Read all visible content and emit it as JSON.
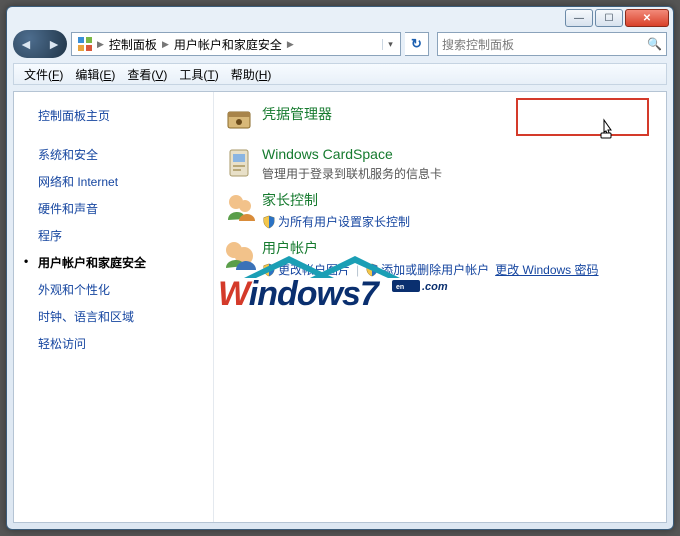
{
  "titlebar": {
    "min": "—",
    "max": "☐",
    "close": "✕"
  },
  "breadcrumb": {
    "items": [
      "控制面板",
      "用户帐户和家庭安全",
      ""
    ]
  },
  "refresh_icon": "↻",
  "search": {
    "placeholder": "搜索控制面板"
  },
  "menus": [
    {
      "pre": "文件(",
      "u": "F",
      "post": ")"
    },
    {
      "pre": "编辑(",
      "u": "E",
      "post": ")"
    },
    {
      "pre": "查看(",
      "u": "V",
      "post": ")"
    },
    {
      "pre": "工具(",
      "u": "T",
      "post": ")"
    },
    {
      "pre": "帮助(",
      "u": "H",
      "post": ")"
    }
  ],
  "sidebar": {
    "items": [
      {
        "label": "控制面板主页"
      },
      {
        "label": "系统和安全"
      },
      {
        "label": "网络和 Internet"
      },
      {
        "label": "硬件和声音"
      },
      {
        "label": "程序"
      },
      {
        "label": "用户帐户和家庭安全",
        "active": true
      },
      {
        "label": "外观和个性化"
      },
      {
        "label": "时钟、语言和区域"
      },
      {
        "label": "轻松访问"
      }
    ]
  },
  "main": {
    "sections": [
      {
        "title": "用户帐户",
        "tasks": [
          {
            "shield": true,
            "label": "更改帐户图片"
          },
          {
            "sep": "|"
          },
          {
            "shield": true,
            "label": "添加或删除用户帐户"
          },
          {
            "label": "更改 Windows 密码",
            "underline": true
          }
        ]
      },
      {
        "title": "家长控制",
        "tasks": [
          {
            "shield": true,
            "label": "为所有用户设置家长控制"
          }
        ]
      },
      {
        "title": "Windows CardSpace",
        "desc": "管理用于登录到联机服务的信息卡"
      },
      {
        "title": "凭据管理器"
      }
    ]
  },
  "watermark": {
    "w": "W",
    "rest": "indows7",
    "tag": "en",
    "dotcom": ".com"
  }
}
